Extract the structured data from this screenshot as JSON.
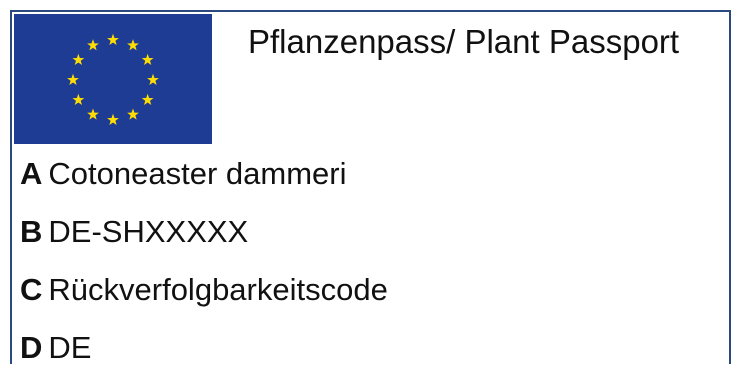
{
  "passport": {
    "title": "Pflanzenpass/ Plant Passport",
    "flag_colors": {
      "background": "#1f3c95",
      "stars": "#ffdd00"
    },
    "fields": [
      {
        "key": "A",
        "value": "Cotoneaster dammeri"
      },
      {
        "key": "B",
        "value": "DE-SHXXXXX"
      },
      {
        "key": "C",
        "value": "Rückverfolgbarkeitscode"
      },
      {
        "key": "D",
        "value": "DE"
      }
    ]
  }
}
